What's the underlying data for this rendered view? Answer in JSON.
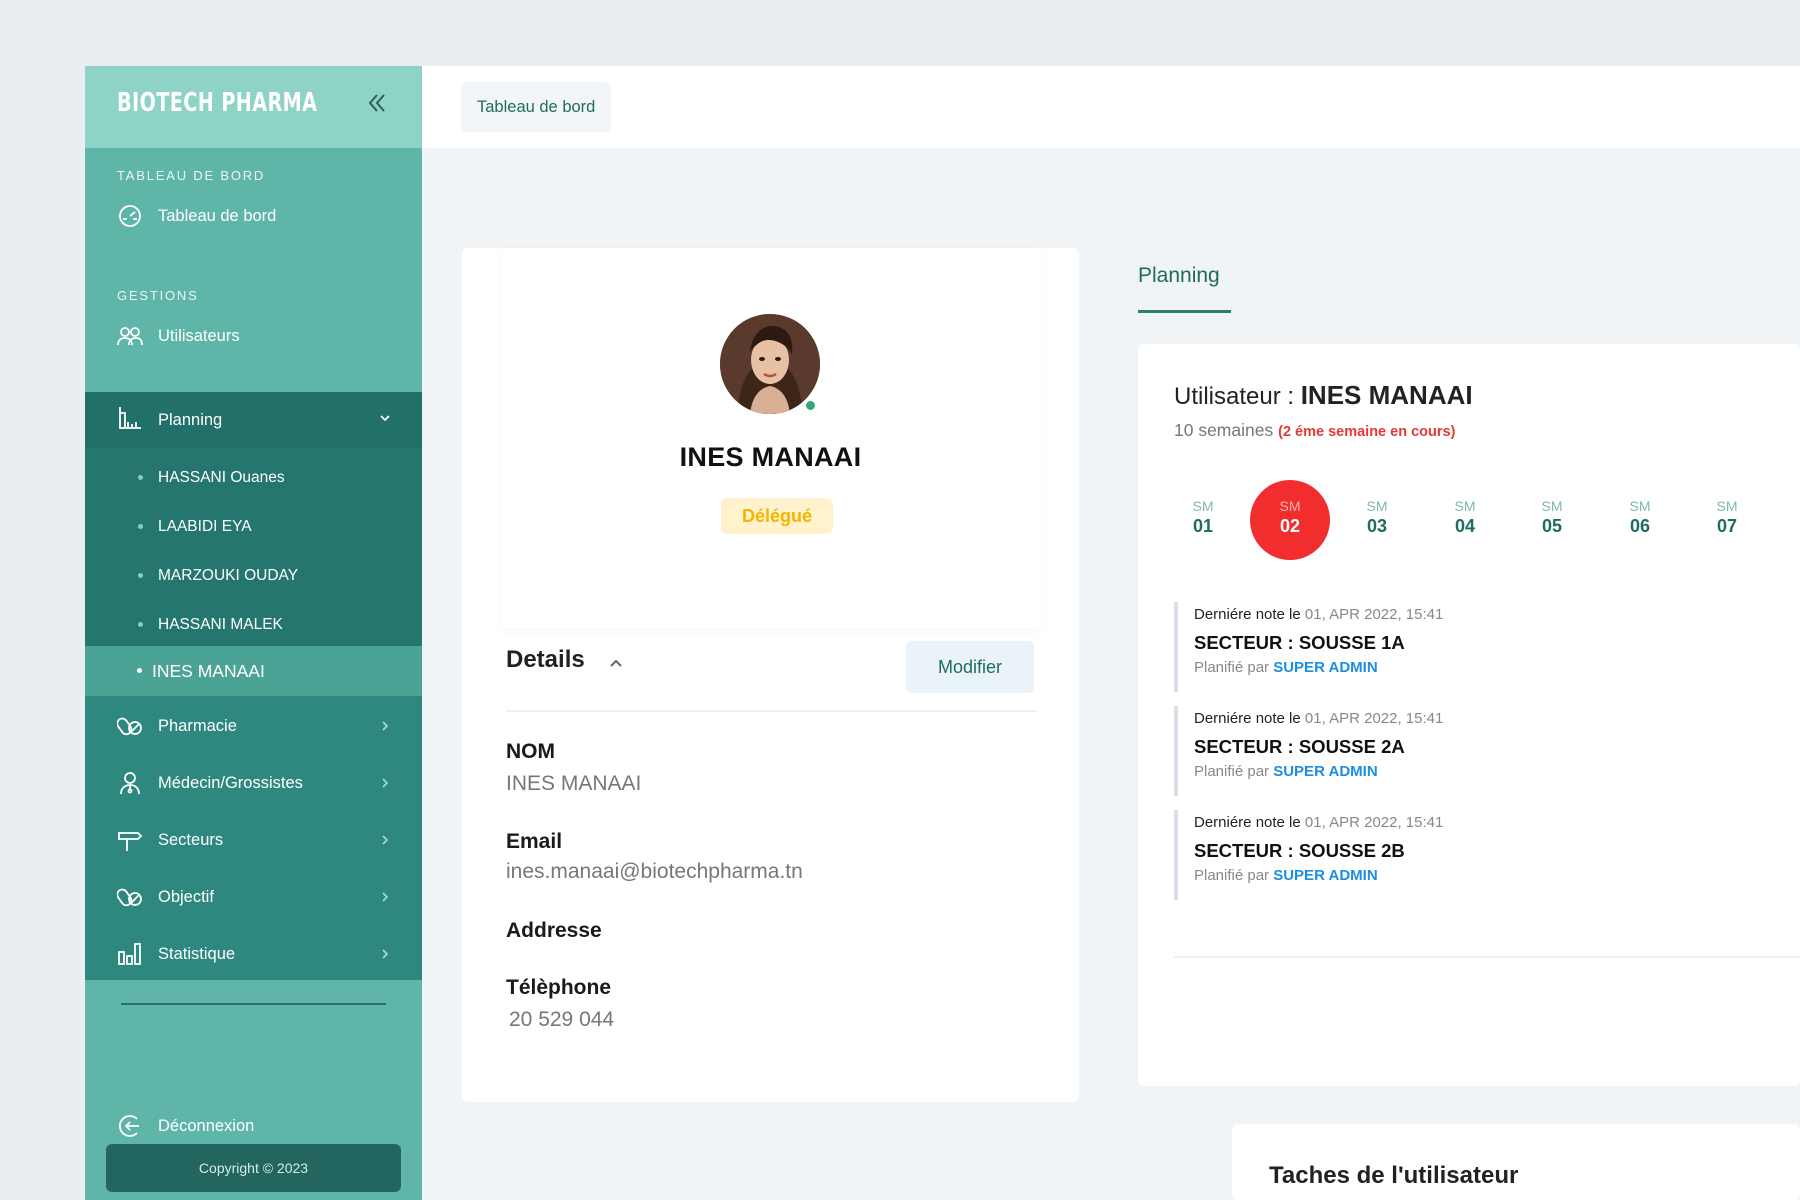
{
  "brand": {
    "name": "BIOTECH PHARMA"
  },
  "sidebar": {
    "sections": [
      {
        "label": "TABLEAU DE BORD"
      },
      {
        "label": "GESTIONS"
      }
    ],
    "items": [
      {
        "label": "Tableau de bord",
        "icon": "dashboard-icon"
      },
      {
        "label": "Utilisateurs",
        "icon": "users-icon"
      },
      {
        "label": "Planning",
        "icon": "planning-icon"
      },
      {
        "label": "Pharmacie",
        "icon": "pills-icon"
      },
      {
        "label": "Médecin/Grossistes",
        "icon": "doctor-icon"
      },
      {
        "label": "Secteurs",
        "icon": "signpost-icon"
      },
      {
        "label": "Objectif",
        "icon": "pills-icon"
      },
      {
        "label": "Statistique",
        "icon": "bar-chart-icon"
      }
    ],
    "planning_sub": [
      "HASSANI Ouanes",
      "LAABIDI EYA",
      "MARZOUKI OUDAY",
      "HASSANI MALEK",
      "INES MANAAI"
    ],
    "logout": "Déconnexion",
    "copyright": "Copyright © 2023"
  },
  "topbar": {
    "breadcrumb": "Tableau de bord"
  },
  "profile": {
    "name": "INES MANAAI",
    "role": "Délégué",
    "details_title": "Details",
    "modify_label": "Modifier",
    "fields": [
      {
        "label": "NOM",
        "value": "INES MANAAI"
      },
      {
        "label": "Email",
        "value": "ines.manaai@biotechpharma.tn"
      },
      {
        "label": "Addresse",
        "value": ""
      },
      {
        "label": "Télèphone",
        "value": "20 529 044"
      }
    ]
  },
  "planning": {
    "tab_label": "Planning",
    "user_prefix": "Utilisateur : ",
    "user_name": "INES MANAAI",
    "weeks_total": "10 semaines",
    "current_week_note": "(2 éme semaine en cours)",
    "weeks": [
      {
        "sm": "SM",
        "num": "01"
      },
      {
        "sm": "SM",
        "num": "02"
      },
      {
        "sm": "SM",
        "num": "03"
      },
      {
        "sm": "SM",
        "num": "04"
      },
      {
        "sm": "SM",
        "num": "05"
      },
      {
        "sm": "SM",
        "num": "06"
      },
      {
        "sm": "SM",
        "num": "07"
      }
    ],
    "active_week": "02",
    "notes": [
      {
        "prefix": "Derniére note le",
        "date": "01, APR 2022, 15:41",
        "sector": "SECTEUR : SOUSSE 1A",
        "planned_by": "Planifié par",
        "admin": "SUPER ADMIN"
      },
      {
        "prefix": "Derniére note le",
        "date": "01, APR 2022, 15:41",
        "sector": "SECTEUR : SOUSSE 2A",
        "planned_by": "Planifié par",
        "admin": "SUPER ADMIN"
      },
      {
        "prefix": "Derniére note le",
        "date": "01, APR 2022, 15:41",
        "sector": "SECTEUR : SOUSSE 2B",
        "planned_by": "Planifié par",
        "admin": "SUPER ADMIN"
      }
    ]
  },
  "tasks": {
    "title": "Taches de l'utilisateur"
  },
  "colors": {
    "sidebar": "#5eb5a8",
    "sidebar_active": "#21706a",
    "accent": "#1f6b5f",
    "active_week": "#f22d2d",
    "role_badge": "#f4b400",
    "link_blue": "#1f8de0"
  }
}
